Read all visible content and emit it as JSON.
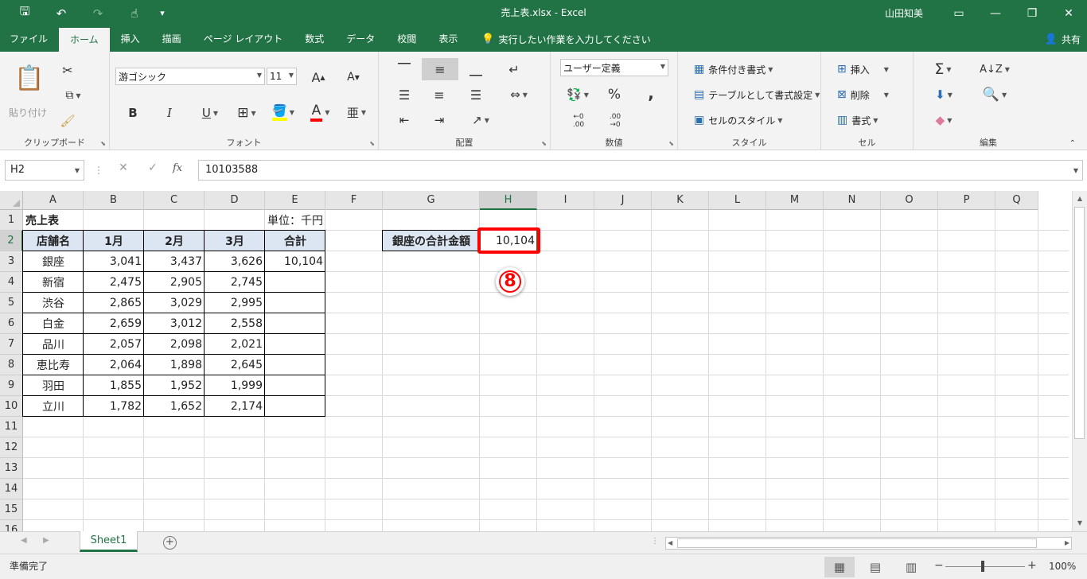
{
  "titlebar": {
    "qat": {
      "save": "🖫",
      "undo": "↶",
      "redo": "↷",
      "touch": "☝",
      "customize": "▾"
    },
    "doc_title": "売上表.xlsx  -  Excel",
    "user": "山田知美",
    "ribbon_display": "▭",
    "minimize": "—",
    "restore": "❐",
    "close": "✕"
  },
  "tabs": {
    "items": [
      "ファイル",
      "ホーム",
      "挿入",
      "描画",
      "ページ レイアウト",
      "数式",
      "データ",
      "校閲",
      "表示"
    ],
    "tell_me": "実行したい作業を入力してください",
    "share": "共有"
  },
  "ribbon": {
    "clipboard": {
      "paste": "貼り付け",
      "label": "クリップボード"
    },
    "font": {
      "font_name": "游ゴシック",
      "font_size": "11",
      "bold": "B",
      "italic": "I",
      "underline": "U",
      "grow": "A",
      "shrink": "A",
      "font_color": "A",
      "label": "フォント"
    },
    "alignment": {
      "label": "配置"
    },
    "number": {
      "format": "ユーザー定義",
      "percent": "%",
      "comma": ",",
      "inc": ".00",
      "dec": ".00",
      "label": "数値"
    },
    "styles": {
      "conditional": "条件付き書式",
      "table": "テーブルとして書式設定",
      "cell_styles": "セルのスタイル",
      "label": "スタイル"
    },
    "cells": {
      "insert": "挿入",
      "delete": "削除",
      "format": "書式",
      "label": "セル"
    },
    "editing": {
      "sum": "Σ",
      "label": "編集"
    }
  },
  "formula_bar": {
    "name_box": "H2",
    "cancel": "✕",
    "enter": "✓",
    "fx": "fx",
    "value": "10103588"
  },
  "sheet": {
    "columns": [
      "A",
      "B",
      "C",
      "D",
      "E",
      "F",
      "G",
      "H",
      "I",
      "J",
      "K",
      "L",
      "M",
      "N",
      "O",
      "P",
      "Q"
    ],
    "rows": [
      "1",
      "2",
      "3",
      "4",
      "5",
      "6",
      "7",
      "8",
      "9",
      "10",
      "11",
      "12",
      "13",
      "14",
      "15",
      "16"
    ],
    "selected_column": "H",
    "selected_row": "2",
    "title": "売上表",
    "unit": "単位：千円",
    "headers": [
      "店舗名",
      "1月",
      "2月",
      "3月",
      "合計"
    ],
    "data": [
      [
        "銀座",
        "3,041",
        "3,437",
        "3,626",
        "10,104"
      ],
      [
        "新宿",
        "2,475",
        "2,905",
        "2,745",
        ""
      ],
      [
        "渋谷",
        "2,865",
        "3,029",
        "2,995",
        ""
      ],
      [
        "白金",
        "2,659",
        "3,012",
        "2,558",
        ""
      ],
      [
        "品川",
        "2,057",
        "2,098",
        "2,021",
        ""
      ],
      [
        "恵比寿",
        "2,064",
        "1,898",
        "2,645",
        ""
      ],
      [
        "羽田",
        "1,855",
        "1,952",
        "1,999",
        ""
      ],
      [
        "立川",
        "1,782",
        "1,652",
        "2,174",
        ""
      ]
    ],
    "summary_label": "銀座の合計金額",
    "summary_value": "10,104",
    "callout_step": "8",
    "highlight_color": "#ff0000",
    "header_fill": "#dce6f2",
    "accent": "#217346"
  },
  "sheet_tabs": {
    "active": "Sheet1",
    "add": "+"
  },
  "status": {
    "text": "準備完了",
    "zoom": "100%",
    "zoom_minus": "−",
    "zoom_plus": "+"
  }
}
